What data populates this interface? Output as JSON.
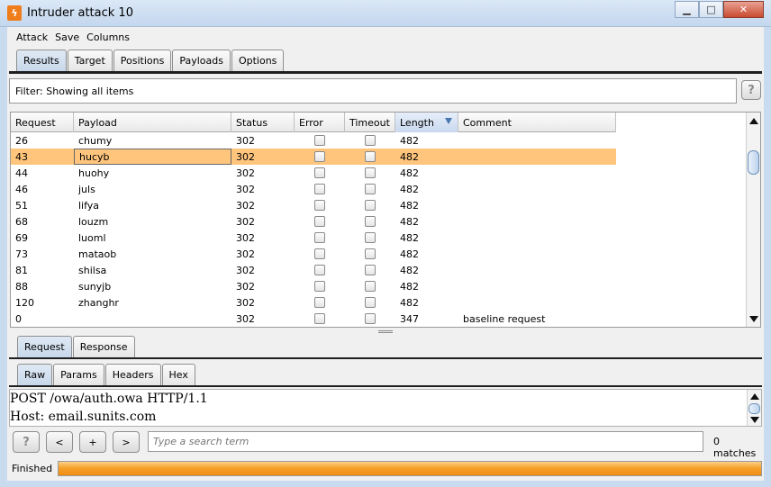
{
  "window": {
    "title": "Intruder attack 10",
    "icon": "burp-lightning-icon",
    "controls": [
      "minimize",
      "maximize",
      "close"
    ]
  },
  "menu": [
    "Attack",
    "Save",
    "Columns"
  ],
  "tabs": {
    "items": [
      "Results",
      "Target",
      "Positions",
      "Payloads",
      "Options"
    ],
    "active": "Results"
  },
  "filter": {
    "text": "Filter:  Showing all items",
    "help_label": "?"
  },
  "table": {
    "columns": [
      "Request",
      "Payload",
      "Status",
      "Error",
      "Timeout",
      "Length",
      "Comment"
    ],
    "sorted_column": "Length",
    "selected_row": 1,
    "rows": [
      {
        "request": "26",
        "payload": "chumy",
        "status": "302",
        "error": false,
        "timeout": false,
        "length": "482",
        "comment": ""
      },
      {
        "request": "43",
        "payload": "hucyb",
        "status": "302",
        "error": false,
        "timeout": false,
        "length": "482",
        "comment": ""
      },
      {
        "request": "44",
        "payload": "huohy",
        "status": "302",
        "error": false,
        "timeout": false,
        "length": "482",
        "comment": ""
      },
      {
        "request": "46",
        "payload": "juls",
        "status": "302",
        "error": false,
        "timeout": false,
        "length": "482",
        "comment": ""
      },
      {
        "request": "51",
        "payload": "lifya",
        "status": "302",
        "error": false,
        "timeout": false,
        "length": "482",
        "comment": ""
      },
      {
        "request": "68",
        "payload": "louzm",
        "status": "302",
        "error": false,
        "timeout": false,
        "length": "482",
        "comment": ""
      },
      {
        "request": "69",
        "payload": "luoml",
        "status": "302",
        "error": false,
        "timeout": false,
        "length": "482",
        "comment": ""
      },
      {
        "request": "73",
        "payload": "mataob",
        "status": "302",
        "error": false,
        "timeout": false,
        "length": "482",
        "comment": ""
      },
      {
        "request": "81",
        "payload": "shilsa",
        "status": "302",
        "error": false,
        "timeout": false,
        "length": "482",
        "comment": ""
      },
      {
        "request": "88",
        "payload": "sunyjb",
        "status": "302",
        "error": false,
        "timeout": false,
        "length": "482",
        "comment": ""
      },
      {
        "request": "120",
        "payload": "zhanghr",
        "status": "302",
        "error": false,
        "timeout": false,
        "length": "482",
        "comment": ""
      },
      {
        "request": "0",
        "payload": "",
        "status": "302",
        "error": false,
        "timeout": false,
        "length": "347",
        "comment": "baseline request"
      }
    ]
  },
  "detail_tabs": {
    "items": [
      "Request",
      "Response"
    ],
    "active": "Request"
  },
  "view_tabs": {
    "items": [
      "Raw",
      "Params",
      "Headers",
      "Hex"
    ],
    "active": "Raw"
  },
  "editor": {
    "lines": [
      "POST /owa/auth.owa HTTP/1.1",
      "Host: email.sunits.com"
    ]
  },
  "search": {
    "help_label": "?",
    "prev_label": "<",
    "add_label": "+",
    "next_label": ">",
    "placeholder": "Type a search term",
    "matches": "0 matches"
  },
  "status": {
    "label": "Finished",
    "progress": 1.0
  },
  "colors": {
    "selected_row": "#ffc57d",
    "progress": "#f08d10",
    "active_tab": "#c7d8ea"
  }
}
